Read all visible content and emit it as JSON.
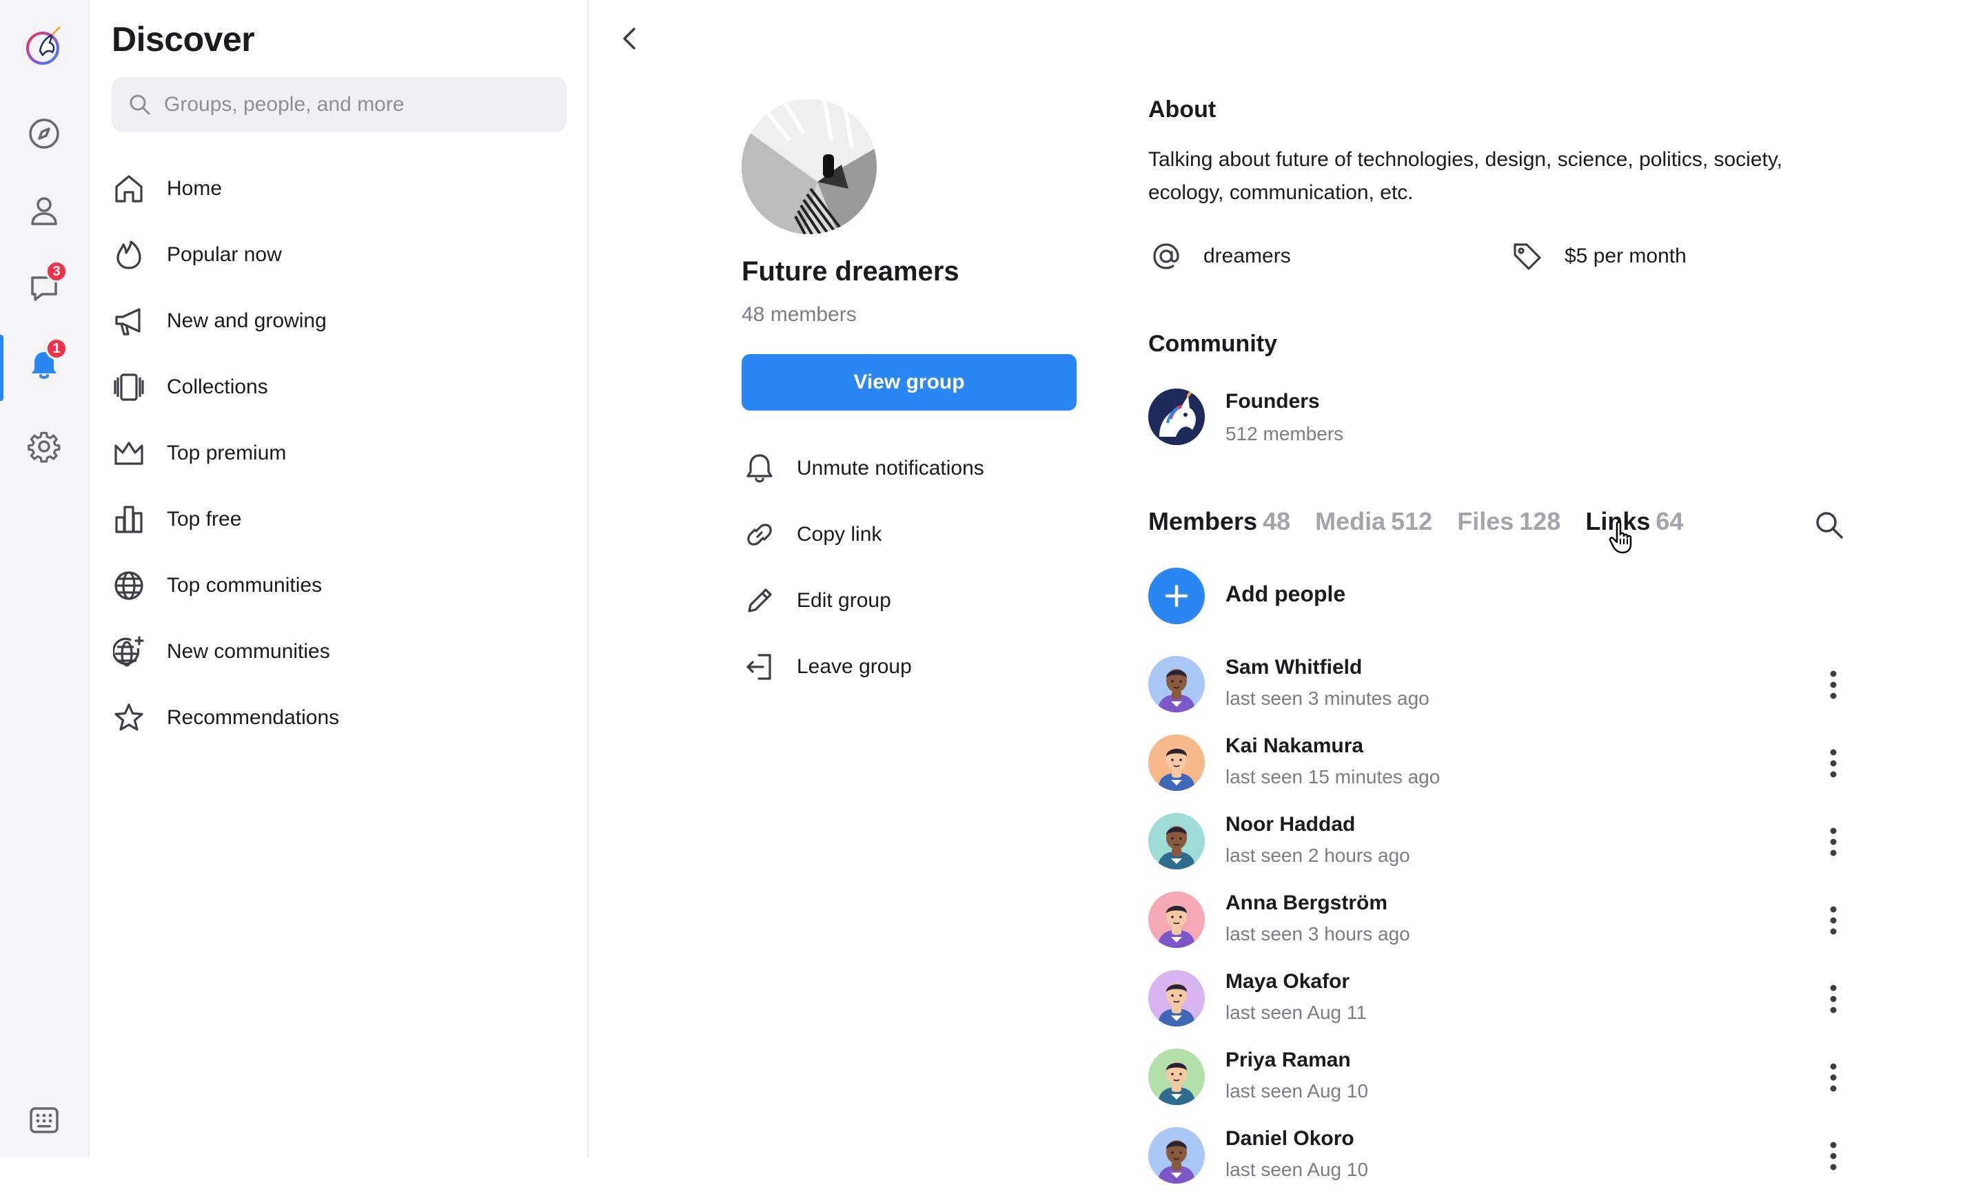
{
  "rail": {
    "items": [
      {
        "name": "logo-icon"
      },
      {
        "name": "compass-icon"
      },
      {
        "name": "person-icon"
      },
      {
        "name": "chat-icon",
        "badge": "3"
      },
      {
        "name": "bell-icon",
        "badge": "1"
      },
      {
        "name": "gear-icon"
      },
      {
        "name": "keyboard-icon"
      }
    ]
  },
  "sidebar": {
    "title": "Discover",
    "search_placeholder": "Groups, people, and more",
    "items": [
      {
        "label": "Home",
        "icon": "home-icon"
      },
      {
        "label": "Popular now",
        "icon": "flame-icon"
      },
      {
        "label": "New and growing",
        "icon": "megaphone-icon"
      },
      {
        "label": "Collections",
        "icon": "collections-icon"
      },
      {
        "label": "Top premium",
        "icon": "crown-icon"
      },
      {
        "label": "Top free",
        "icon": "bar-chart-icon"
      },
      {
        "label": "Top communities",
        "icon": "globe-icon"
      },
      {
        "label": "New communities",
        "icon": "globe-sparkle-icon"
      },
      {
        "label": "Recommendations",
        "icon": "star-icon"
      }
    ]
  },
  "group": {
    "name": "Future dreamers",
    "members": "48 members",
    "view_button": "View group",
    "actions": [
      {
        "label": "Unmute notifications",
        "icon": "bell-icon"
      },
      {
        "label": "Copy link",
        "icon": "link-icon"
      },
      {
        "label": "Edit group",
        "icon": "pencil-icon"
      },
      {
        "label": "Leave group",
        "icon": "leave-icon"
      }
    ]
  },
  "about": {
    "title": "About",
    "text": "Talking about future of technologies, design,  science, politics, society, ecology, communication, etc.",
    "handle": "dreamers",
    "price": "$5 per month"
  },
  "community": {
    "title": "Community",
    "name": "Founders",
    "members": "512 members"
  },
  "tabs": [
    {
      "label": "Members",
      "count": "48",
      "active": true
    },
    {
      "label": "Media",
      "count": "512"
    },
    {
      "label": "Files",
      "count": "128"
    },
    {
      "label": "Links",
      "count": "64",
      "hover": true
    }
  ],
  "add_people": "Add people",
  "members": [
    {
      "name": "Sam Whitfield",
      "last_seen": "last seen 3 minutes ago",
      "bg": "#a9c8f5",
      "skin": "#8a5a3c",
      "shirt": "#7b57c9"
    },
    {
      "name": "Kai Nakamura",
      "last_seen": "last seen 15 minutes ago",
      "bg": "#f7b98a",
      "skin": "#f3c9a3",
      "shirt": "#3f67b8"
    },
    {
      "name": "Noor Haddad",
      "last_seen": "last seen 2 hours ago",
      "bg": "#9fdcd6",
      "skin": "#8a5a3c",
      "shirt": "#2e6b8f"
    },
    {
      "name": "Anna Bergström",
      "last_seen": "last seen 3 hours ago",
      "bg": "#f5a9b4",
      "skin": "#f3c9a3",
      "shirt": "#7b57c9"
    },
    {
      "name": "Maya Okafor",
      "last_seen": "last seen Aug 11",
      "bg": "#d8b4f0",
      "skin": "#f3c9a3",
      "shirt": "#3f67b8"
    },
    {
      "name": "Priya Raman",
      "last_seen": "last seen Aug 10",
      "bg": "#b3e0a9",
      "skin": "#f3c9a3",
      "shirt": "#2e6b8f"
    },
    {
      "name": "Daniel Okoro",
      "last_seen": "last seen Aug 10",
      "bg": "#a9c8f5",
      "skin": "#8a5a3c",
      "shirt": "#7b57c9"
    }
  ],
  "colors": {
    "accent": "#2a86f2",
    "badge": "#f2304a"
  }
}
